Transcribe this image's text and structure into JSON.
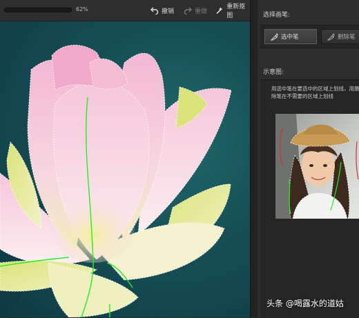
{
  "toolbar": {
    "zoom": "62%",
    "undo_label": "撤销",
    "redo_label": "重做",
    "reset_label": "重新抠图"
  },
  "panel": {
    "select_brush_title": "选择画笔:",
    "brushes": [
      {
        "label": "选中笔",
        "active": true
      },
      {
        "label": "删除笔",
        "active": false
      }
    ],
    "example_title": "示意图:",
    "hint": "用选中笔在要选中的区域上划线，用删除笔在不需要的区域上划线"
  },
  "watermark": "头条 @喝露水的道姑",
  "colors": {
    "select_stroke": "#22ee22",
    "delete_stroke": "#d03030",
    "background": "#2d2d2d"
  },
  "icons": {
    "undo": "undo-icon",
    "redo": "redo-icon",
    "reset": "reset-icon",
    "select_brush": "select-brush-icon",
    "delete_brush": "delete-brush-icon"
  }
}
